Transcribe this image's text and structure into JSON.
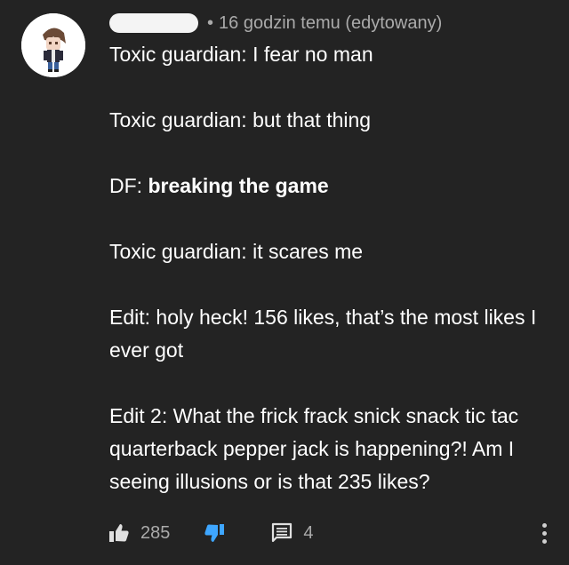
{
  "header": {
    "separator": "•",
    "timestamp": "16 godzin temu (edytowany)"
  },
  "comment": {
    "line1": "Toxic guardian: I fear no man",
    "line2": "Toxic guardian: but that thing",
    "line3_prefix": "DF: ",
    "line3_bold": "breaking the game",
    "line4": "Toxic guardian: it scares me",
    "line5": "Edit: holy heck! 156 likes, that’s the most likes I ever got",
    "line6": "Edit 2: What the frick frack snick snack tic tac quarterback pepper jack is happening?! Am I seeing illusions or is that 235 likes?"
  },
  "actions": {
    "like_count": "285",
    "reply_count": "4"
  },
  "colors": {
    "background": "#232323",
    "text": "#ffffff",
    "secondary_text": "#aaaaaa",
    "dislike_active": "#3ea6ff"
  },
  "icons": {
    "like": "thumbs-up-icon",
    "dislike": "thumbs-down-icon",
    "reply": "comment-icon",
    "more": "more-vertical-icon"
  }
}
